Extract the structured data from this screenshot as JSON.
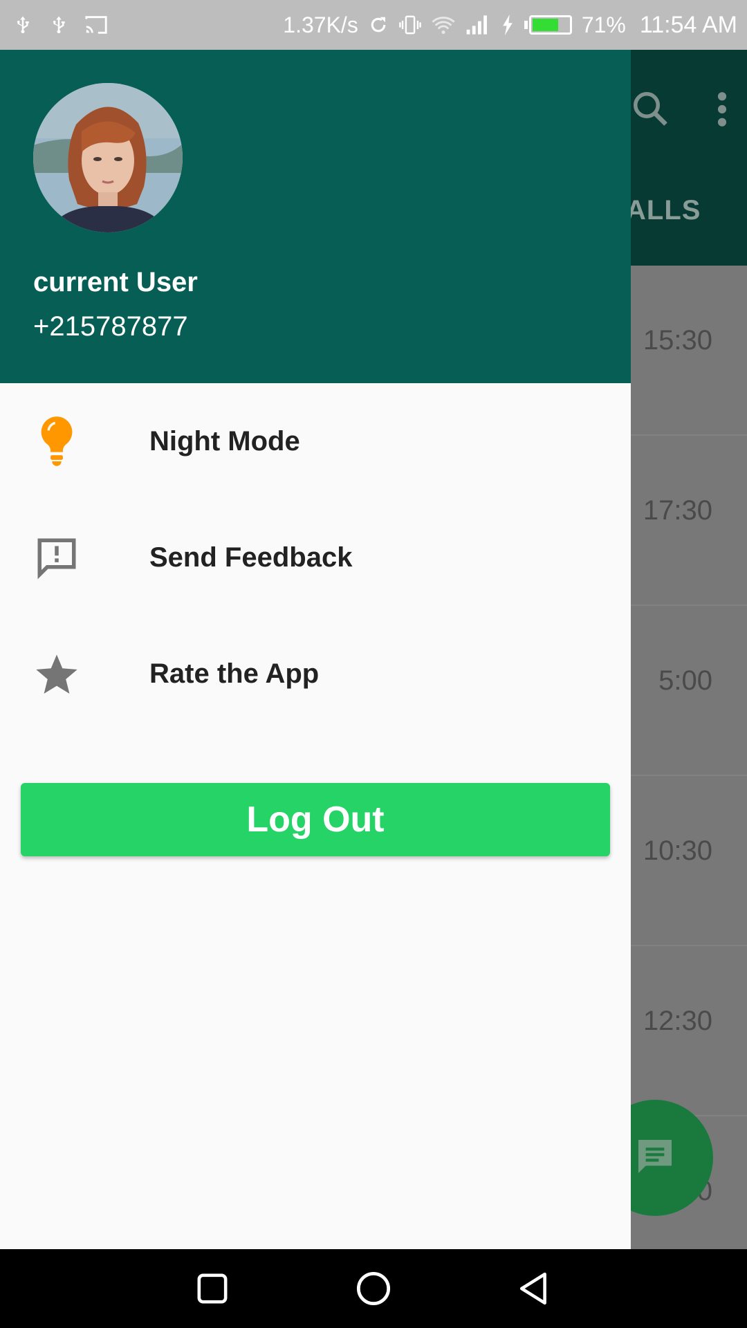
{
  "status_bar": {
    "network_speed": "1.37K/s",
    "battery_percent": "71%",
    "battery_level": 0.71,
    "time": "11:54 AM"
  },
  "background": {
    "tab_visible": "ALLS",
    "times": [
      "15:30",
      "17:30",
      "5:00",
      "10:30",
      "12:30",
      "0"
    ]
  },
  "drawer": {
    "user_name": "current User",
    "user_phone": "+215787877",
    "items": [
      {
        "label": "Night Mode",
        "icon": "lightbulb-icon"
      },
      {
        "label": "Send Feedback",
        "icon": "feedback-icon"
      },
      {
        "label": "Rate the App",
        "icon": "star-icon"
      }
    ],
    "logout_label": "Log Out"
  },
  "colors": {
    "header": "#075e54",
    "accent": "#25d366",
    "night_mode_icon": "#ff9800"
  }
}
